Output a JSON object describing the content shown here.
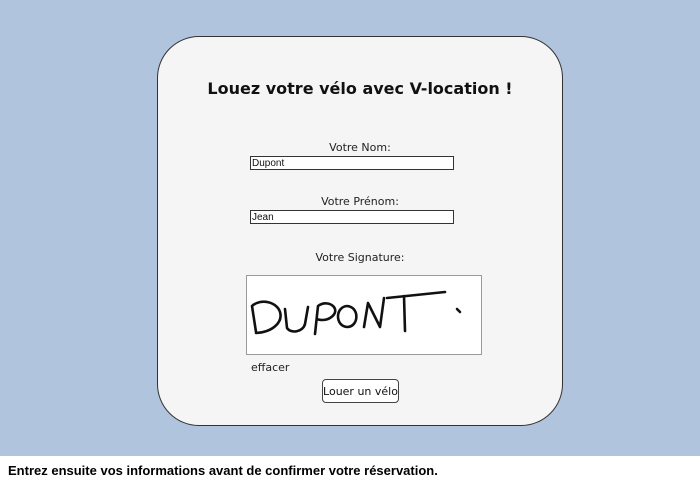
{
  "form": {
    "title": "Louez votre vélo avec V-location !",
    "nom_label": "Votre Nom:",
    "nom_value": "Dupont",
    "prenom_label": "Votre Prénom:",
    "prenom_value": "Jean",
    "signature_label": "Votre Signature:",
    "signature_text": "DUPONT",
    "clear_label": "effacer",
    "submit_label": "Louer un vélo"
  },
  "footer": {
    "text": "Entrez ensuite vos informations avant de confirmer votre réservation."
  },
  "colors": {
    "background": "#b0c4de",
    "card": "#f5f5f5"
  }
}
